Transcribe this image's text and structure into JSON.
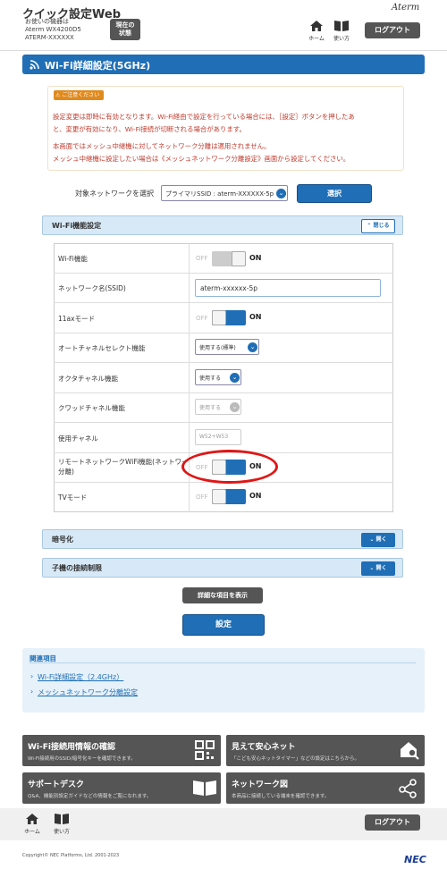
{
  "header": {
    "app_title": "クイック設定Web",
    "device_lines": [
      "お使いの機器は",
      "Aterm WX4200D5",
      "ATERM-XXXXXX"
    ],
    "status_btn": [
      "現在の",
      "状態"
    ],
    "home_label": "ホーム",
    "manual_label": "使い方",
    "logout_label": "ログアウト",
    "brand": "Aterm"
  },
  "page": {
    "title": "Wi-Fi詳細設定(5GHz)"
  },
  "notice": {
    "badge": "ご注意ください",
    "lines": [
      "設定変更は即時に有効となります。Wi-Fi経由で設定を行っている場合には、［設定］ボタンを押したあ",
      "と、変更が有効になり、Wi-Fi接続が切断される場合があります。",
      "本画面ではメッシュ中継機に対してネットワーク分離は適用されません。",
      "メッシュ中継機に設定したい場合は《メッシュネットワーク分離設定》画面から設定してください。"
    ]
  },
  "network_select": {
    "label": "対象ネットワークを選択",
    "value": "プライマリSSID : aterm-XXXXXX-5p",
    "button": "選択"
  },
  "wifi_section": {
    "title": "Wi-Fi機能設定",
    "collapse_label": "閉じる",
    "rows": [
      {
        "label": "Wi-Fi機能",
        "off": "OFF",
        "on": "ON"
      },
      {
        "label": "ネットワーク名(SSID)",
        "value": "aterm-xxxxxx-5p"
      },
      {
        "label": "11axモード",
        "off": "OFF",
        "on": "ON"
      },
      {
        "label": "オートチャネルセレクト機能",
        "value": "使用する(標準)"
      },
      {
        "label": "オクタチャネル機能",
        "value": "使用する"
      },
      {
        "label": "クワッドチャネル機能",
        "value": "使用する"
      },
      {
        "label": "使用チャネル",
        "value": "W52+W53"
      },
      {
        "label": "リモートネットワークWiFi機能(ネットワーク",
        "label2": "分離)",
        "off": "OFF",
        "on": "ON"
      },
      {
        "label": "TVモード",
        "off": "OFF",
        "on": "ON"
      }
    ]
  },
  "encryption_section": {
    "title": "暗号化",
    "open_label": "開く"
  },
  "client_section": {
    "title": "子機の接続制限",
    "open_label": "開く"
  },
  "show_detail_btn": "詳細な項目を表示",
  "apply_btn": "設定",
  "related": {
    "title": "関連項目",
    "links": [
      "Wi-Fi詳細設定（2.4GHz）",
      "メッシュネットワーク分離設定"
    ]
  },
  "banners": [
    {
      "title": "Wi-Fi接続用情報の確認",
      "sub": "Wi-Fi接続用のSSID/暗号化キーを確認できます。",
      "icon": "qr-code-icon"
    },
    {
      "title": "見えて安心ネット",
      "sub": "「こども安心ネットタイマー」などの設定はこちらから。",
      "icon": "house-search-icon"
    },
    {
      "title": "サポートデスク",
      "sub": "Q&A、機能別設定ガイドなどの情報をご覧になれます。",
      "icon": "book-icon"
    },
    {
      "title": "ネットワーク図",
      "sub": "本商品に接続している端末を確認できます。",
      "icon": "network-map-icon"
    }
  ],
  "footer": {
    "home_label": "ホーム",
    "manual_label": "使い方",
    "logout_label": "ログアウト",
    "copyright": "Copyright© NEC Platforms, Ltd. 2001-2023",
    "brand": "NEC"
  },
  "colors": {
    "accent": "#1f6eb6",
    "notice": "#c0392b",
    "highlight": "#e01616"
  }
}
